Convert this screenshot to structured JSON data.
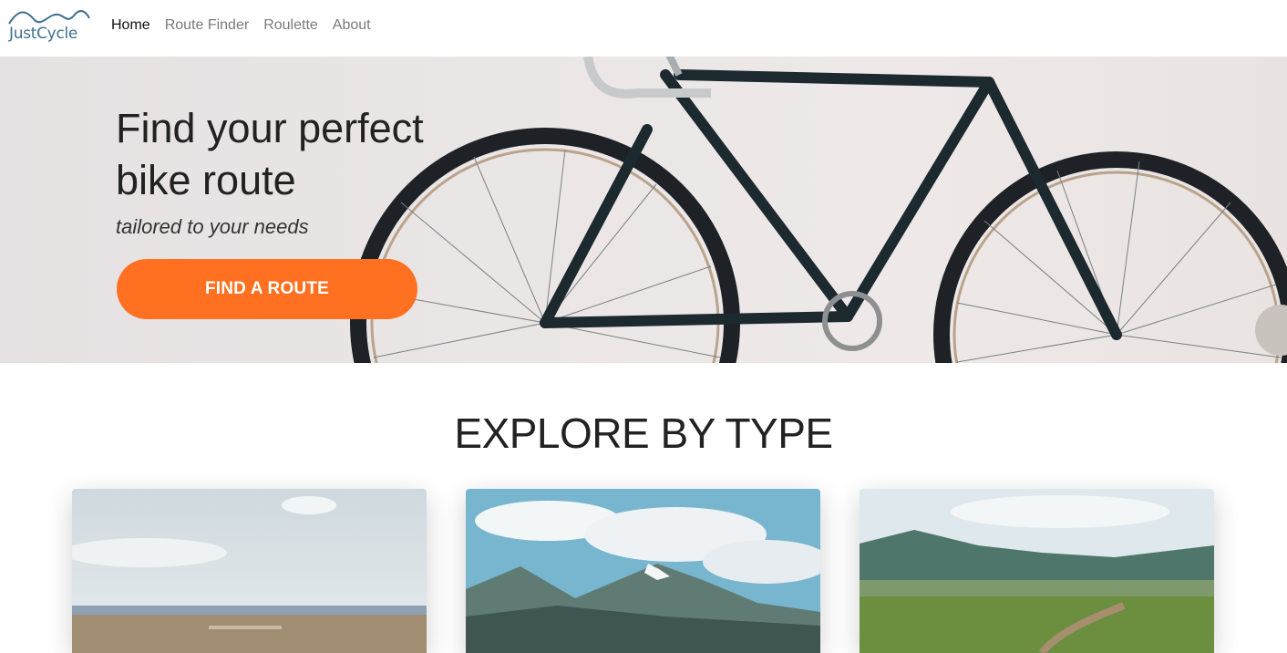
{
  "brand": {
    "name": "JustCycle"
  },
  "nav": {
    "items": [
      {
        "label": "Home",
        "active": true
      },
      {
        "label": "Route Finder",
        "active": false
      },
      {
        "label": "Roulette",
        "active": false
      },
      {
        "label": "About",
        "active": false
      }
    ]
  },
  "hero": {
    "title_line1": "Find your perfect",
    "title_line2": "bike route",
    "subtitle": "tailored to your needs",
    "cta_label": "FIND A ROUTE"
  },
  "explore": {
    "title": "EXPLORE BY TYPE",
    "cards": [
      {
        "image": "flat-plains-image"
      },
      {
        "image": "mountain-peaks-image"
      },
      {
        "image": "valley-trail-image"
      }
    ]
  },
  "colors": {
    "accent": "#ff7020",
    "logo": "#3f6f8f",
    "nav_active": "#111111",
    "nav_inactive": "#7a7a7a"
  }
}
